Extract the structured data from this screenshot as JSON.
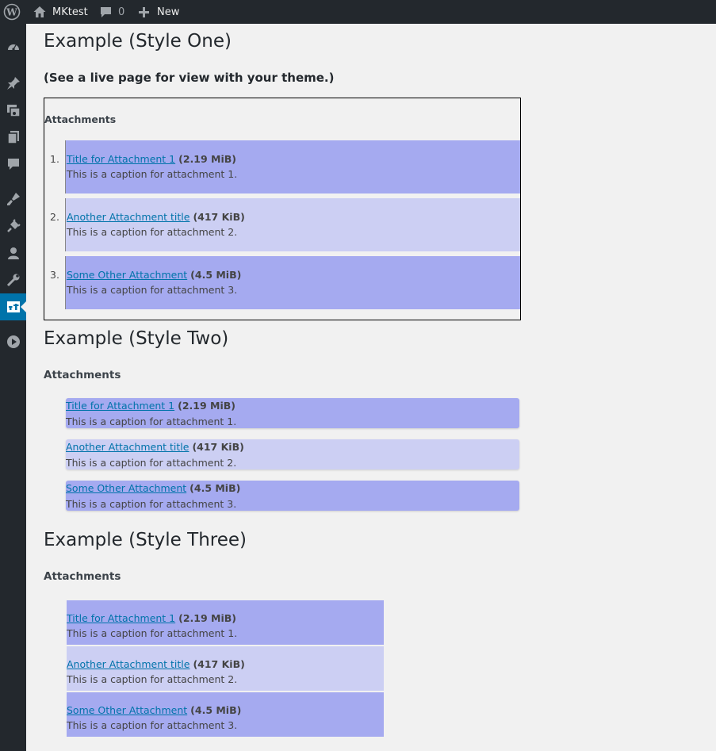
{
  "admin_bar": {
    "logo_icon": "wordpress-logo-icon",
    "site_name": "MKtest",
    "comments_count": "0",
    "new_label": "New"
  },
  "sidebar": {
    "icons": [
      "dashboard-icon",
      "pin-icon",
      "media-icon",
      "pages-icon",
      "comments-icon",
      "appearance-icon",
      "plugins-icon",
      "users-icon",
      "tools-icon",
      "attachments-plugin-icon",
      "play-icon"
    ],
    "current": "attachments-plugin-icon",
    "accent_color": "#0073aa"
  },
  "styles": {
    "dark_bg": "#a5aaf0",
    "light_bg": "#cccff3",
    "link_color": "#0073aa"
  },
  "style_one": {
    "title": "Example (Style One)",
    "subtitle": "(See a live page for view with your theme.)",
    "heading": "Attachments",
    "items": [
      {
        "num": "1.",
        "title": "Title for Attachment 1",
        "size": "(2.19 MiB)",
        "caption": "This is a caption for attachment 1."
      },
      {
        "num": "2.",
        "title": "Another Attachment title",
        "size": "(417 KiB)",
        "caption": "This is a caption for attachment 2."
      },
      {
        "num": "3.",
        "title": "Some Other Attachment",
        "size": "(4.5 MiB)",
        "caption": "This is a caption for attachment 3."
      }
    ]
  },
  "style_two": {
    "title": "Example (Style Two)",
    "heading": "Attachments",
    "items": [
      {
        "title": "Title for Attachment 1",
        "size": "(2.19 MiB)",
        "caption": "This is a caption for attachment 1."
      },
      {
        "title": "Another Attachment title",
        "size": "(417 KiB)",
        "caption": "This is a caption for attachment 2."
      },
      {
        "title": "Some Other Attachment",
        "size": "(4.5 MiB)",
        "caption": "This is a caption for attachment 3."
      }
    ]
  },
  "style_three": {
    "title": "Example (Style Three)",
    "heading": "Attachments",
    "items": [
      {
        "title": "Title for Attachment 1",
        "size": "(2.19 MiB)",
        "caption": "This is a caption for attachment 1."
      },
      {
        "title": "Another Attachment title",
        "size": "(417 KiB)",
        "caption": "This is a caption for attachment 2."
      },
      {
        "title": "Some Other Attachment",
        "size": "(4.5 MiB)",
        "caption": "This is a caption for attachment 3."
      }
    ]
  }
}
